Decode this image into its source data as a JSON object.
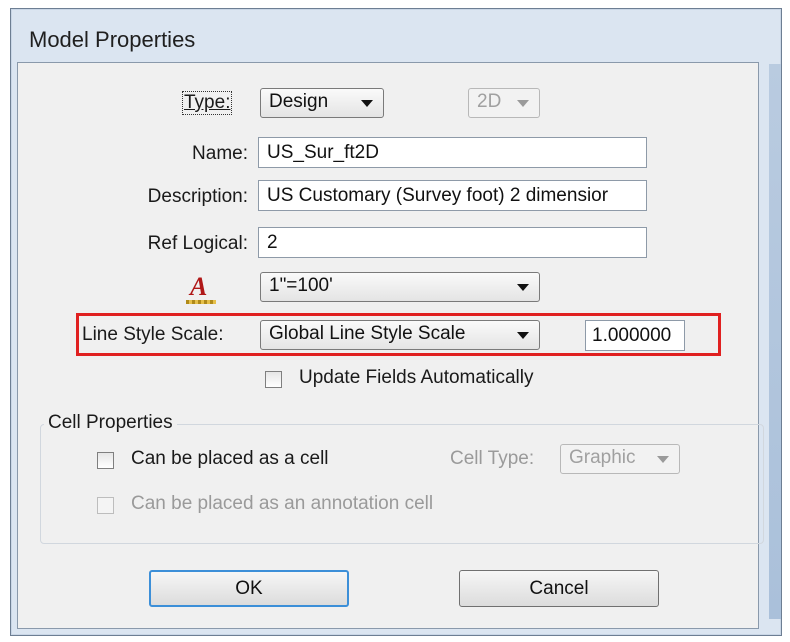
{
  "window": {
    "title": "Model Properties"
  },
  "fields": {
    "type_label": "Type:",
    "type_value": "Design",
    "dimension_value": "2D",
    "name_label": "Name:",
    "name_value": "US_Sur_ft2D",
    "description_label": "Description:",
    "description_value": "US Customary (Survey foot) 2 dimensior",
    "ref_logical_label": "Ref Logical:",
    "ref_logical_value": "2",
    "annotation_scale_icon_glyph": "A",
    "annotation_scale_value": "1\"=100'",
    "line_style_scale_label": "Line Style Scale:",
    "line_style_scale_value": "Global Line Style Scale",
    "line_style_scale_number": "1.000000",
    "update_fields_label": "Update Fields Automatically",
    "update_fields_checked": false
  },
  "cell_properties": {
    "group_label": "Cell Properties",
    "placed_as_cell_label": "Can be placed as a cell",
    "placed_as_cell_checked": false,
    "cell_type_label": "Cell Type:",
    "cell_type_value": "Graphic",
    "annotation_cell_label": "Can be placed as an annotation cell",
    "annotation_cell_checked": false
  },
  "buttons": {
    "ok": "OK",
    "cancel": "Cancel"
  },
  "colors": {
    "highlight": "#e02020",
    "default_button_border": "#3c8fd8",
    "dialog_frame": "#dbe5f1"
  }
}
